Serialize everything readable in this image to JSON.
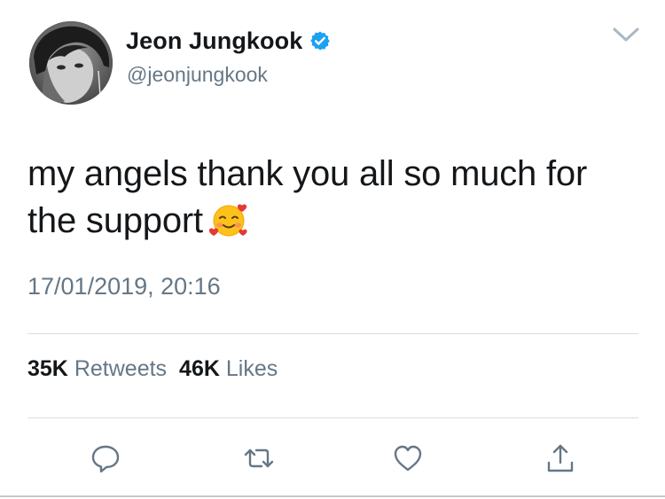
{
  "author": {
    "display_name": "Jeon Jungkook",
    "handle": "@jeonjungkook",
    "verified": true,
    "avatar_icon": "profile-photo"
  },
  "tweet": {
    "text_line1": "my angels thank you all so much for",
    "text_line2": "the support",
    "emoji": "smiling-face-with-hearts-emoji",
    "timestamp": "17/01/2019, 20:16"
  },
  "stats": {
    "retweets_count": "35K",
    "retweets_label": "Retweets",
    "likes_count": "46K",
    "likes_label": "Likes"
  },
  "actions": [
    {
      "name": "reply",
      "icon": "speech-bubble-icon"
    },
    {
      "name": "retweet",
      "icon": "retweet-arrows-icon"
    },
    {
      "name": "like",
      "icon": "heart-icon"
    },
    {
      "name": "share",
      "icon": "share-upload-icon"
    }
  ],
  "colors": {
    "text_primary": "#14171a",
    "text_secondary": "#657786",
    "verified_blue": "#1da1f2",
    "divider": "#d8dde0"
  }
}
